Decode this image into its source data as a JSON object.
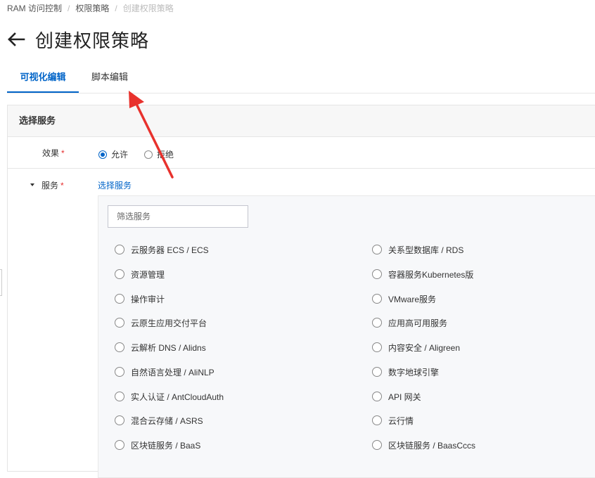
{
  "breadcrumb": {
    "items": [
      "RAM 访问控制",
      "权限策略"
    ],
    "current": "创建权限策略"
  },
  "page": {
    "title": "创建权限策略"
  },
  "tabs": [
    {
      "label": "可视化编辑",
      "active": true
    },
    {
      "label": "脚本编辑",
      "active": false
    }
  ],
  "panel": {
    "header": "选择服务",
    "effect": {
      "label": "效果",
      "required_mark": "*",
      "options": [
        {
          "label": "允许",
          "checked": true
        },
        {
          "label": "拒绝",
          "checked": false
        }
      ]
    },
    "service": {
      "label": "服务",
      "required_mark": "*",
      "link": "选择服务",
      "filter_placeholder": "筛选服务",
      "filter_value": "",
      "items_left": [
        "云服务器 ECS / ECS",
        "资源管理",
        "操作审计",
        "云原生应用交付平台",
        "云解析 DNS / Alidns",
        "自然语言处理 / AliNLP",
        "实人认证 / AntCloudAuth",
        "混合云存储 / ASRS",
        "区块链服务 / BaaS"
      ],
      "items_right": [
        "关系型数据库 / RDS",
        "容器服务Kubernetes版",
        "VMware服务",
        "应用高可用服务",
        "内容安全 / Aligreen",
        "数字地球引擎",
        "API 网关",
        "云行情",
        "区块链服务 / BaasCccs"
      ]
    }
  },
  "colors": {
    "accent": "#0064c8",
    "required": "#e62e2e",
    "annotation": "#e8322d"
  }
}
